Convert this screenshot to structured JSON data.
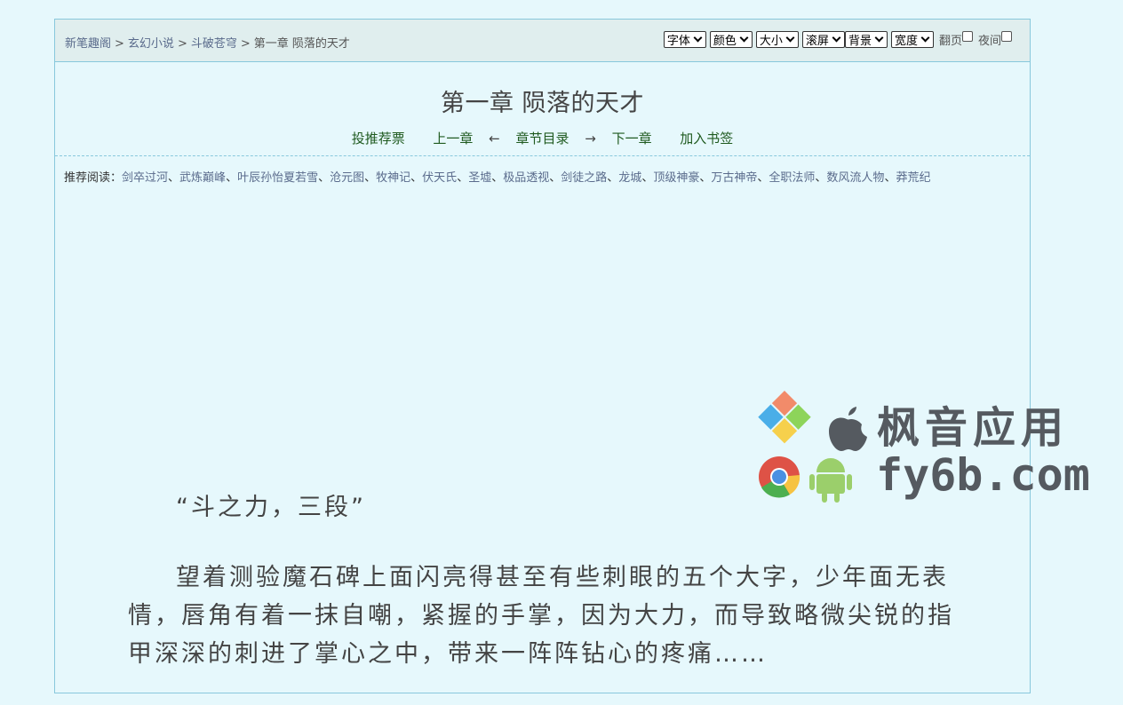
{
  "breadcrumb": {
    "items": [
      "新笔趣阁",
      "玄幻小说",
      "斗破苍穹"
    ],
    "separator": ">",
    "current": "第一章 陨落的天才"
  },
  "toolbar": {
    "font_label": "字体",
    "color_label": "颜色",
    "size_label": "大小",
    "scroll_label": "滚屏",
    "background_label": "背景",
    "width_label": "宽度",
    "page_flip_label": "翻页",
    "night_label": "夜间"
  },
  "chapter": {
    "title": "第一章 陨落的天才"
  },
  "nav": {
    "vote": "投推荐票",
    "prev": "上一章",
    "left_arrow": "←",
    "toc": "章节目录",
    "right_arrow": "→",
    "next": "下一章",
    "bookmark": "加入书签"
  },
  "recommend": {
    "label": "推荐阅读：",
    "books": [
      "剑卒过河",
      "武炼巅峰",
      "叶辰孙怡夏若雪",
      "沧元图",
      "牧神记",
      "伏天氏",
      "圣墟",
      "极品透视",
      "剑徒之路",
      "龙城",
      "顶级神豪",
      "万古神帝",
      "全职法师",
      "数风流人物",
      "莽荒纪"
    ],
    "separator": "、"
  },
  "content": {
    "paragraphs": [
      "“斗之力，三段”",
      "望着测验魔石碑上面闪亮得甚至有些刺眼的五个大字，少年面无表情，唇角有着一抹自嘲，紧握的手掌，因为大力，而导致略微尖锐的指甲深深的刺进了掌心之中，带来一阵阵钻心的疼痛……"
    ]
  },
  "watermark": {
    "cn": "枫音应用",
    "en": "fy6b.com"
  },
  "colors": {
    "page_bg": "#e6f8fc",
    "topbar_bg": "#e0eeee",
    "border": "#88c8dc",
    "link": "#5a6b8c",
    "nav_link": "#1f5a1f",
    "text": "#444444"
  }
}
